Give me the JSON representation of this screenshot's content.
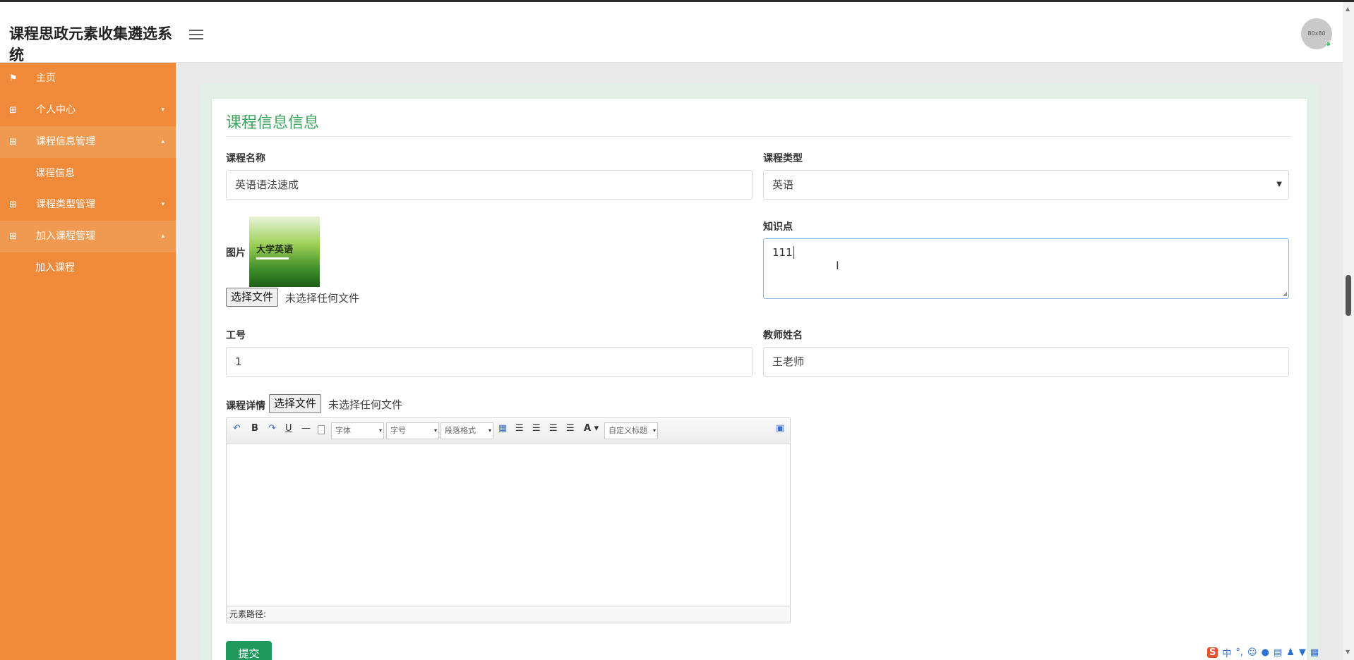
{
  "app": {
    "title": "课程思政元素收集遴选系统",
    "avatar_text": "80x80"
  },
  "sidebar": {
    "items": [
      {
        "icon": "⚑",
        "label": "主页",
        "caret": ""
      },
      {
        "icon": "⊞",
        "label": "个人中心",
        "caret": "▾"
      },
      {
        "icon": "⊞",
        "label": "课程信息管理",
        "caret": "▴",
        "sub": "课程信息"
      },
      {
        "icon": "⊞",
        "label": "课程类型管理",
        "caret": "▾"
      },
      {
        "icon": "⊞",
        "label": "加入课程管理",
        "caret": "▴",
        "sub": "加入课程"
      }
    ]
  },
  "form": {
    "title": "课程信息信息",
    "course_name": {
      "label": "课程名称",
      "value": "英语语法速成"
    },
    "course_type": {
      "label": "课程类型",
      "value": "英语"
    },
    "image": {
      "label": "图片",
      "cover_text": "大学英语",
      "file_button": "选择文件",
      "file_note": "未选择任何文件"
    },
    "knowledge": {
      "label": "知识点",
      "value": "111"
    },
    "staff_id": {
      "label": "工号",
      "value": "1"
    },
    "teacher_name": {
      "label": "教师姓名",
      "value": "王老师"
    },
    "detail": {
      "label": "课程详情",
      "file_button": "选择文件",
      "file_note": "未选择任何文件"
    },
    "submit_label": "提交"
  },
  "editor": {
    "font_placeholder": "字体",
    "size_placeholder": "字号",
    "paragraph_placeholder": "段落格式",
    "custom_title_placeholder": "自定义标题",
    "footer": "元素路径:",
    "buttons": [
      "↶",
      "B",
      "↷",
      "U",
      "—",
      "A"
    ]
  },
  "ime": {
    "logo": "S",
    "lang": "中"
  },
  "colors": {
    "sidebar": "#ee8a3a",
    "accent": "#3da35d",
    "submit": "#1f9a5c"
  }
}
